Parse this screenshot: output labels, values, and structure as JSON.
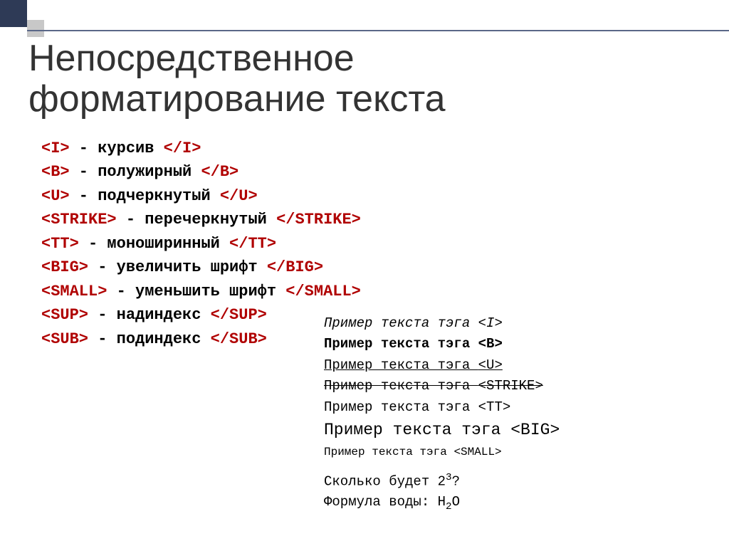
{
  "title_line1": "Непосредственное",
  "title_line2": "форматирование текста",
  "tags": [
    {
      "open": "<I>",
      "desc": " - курсив ",
      "close": "</I>"
    },
    {
      "open": "<B>",
      "desc": " - полужирный ",
      "close": "</B>"
    },
    {
      "open": "<U>",
      "desc": " - подчеркнутый ",
      "close": "</U>"
    },
    {
      "open": "<STRIKE>",
      "desc": " - перечеркнутый ",
      "close": "</STRIKE>"
    },
    {
      "open": "<TT>",
      "desc": " - моноширинный ",
      "close": "</TT>"
    },
    {
      "open": "<BIG>",
      "desc": " - увеличить шрифт ",
      "close": "</BIG>"
    },
    {
      "open": "<SMALL>",
      "desc": " - уменьшить шрифт ",
      "close": "</SMALL>"
    },
    {
      "open": "<SUP>",
      "desc": " - надиндекс ",
      "close": "</SUP>"
    },
    {
      "open": "<SUB>",
      "desc": " - подиндекс ",
      "close": "</SUB>"
    }
  ],
  "examples": {
    "i": {
      "text": "Пример текста тэга ",
      "tag": "<I>"
    },
    "b": {
      "text": "Пример текста тэга ",
      "tag": "<B>"
    },
    "u": {
      "text": "Пример текста тэга ",
      "tag": "<U>"
    },
    "strike": {
      "text": "Пример текста тэга ",
      "tag": "<STRIKE>"
    },
    "tt": {
      "text": "Пример текста тэга ",
      "tag": "<TT>"
    },
    "big": {
      "text": "Пример текста тэга ",
      "tag": "<BIG>"
    },
    "small": {
      "text": "Пример текста тэга ",
      "tag": "<SMALL>"
    },
    "sup_line": {
      "prefix": "Сколько будет 2",
      "sup": "3",
      "suffix": "?"
    },
    "sub_line": {
      "prefix": "Формула воды: H",
      "sub": "2",
      "suffix": "O"
    }
  }
}
